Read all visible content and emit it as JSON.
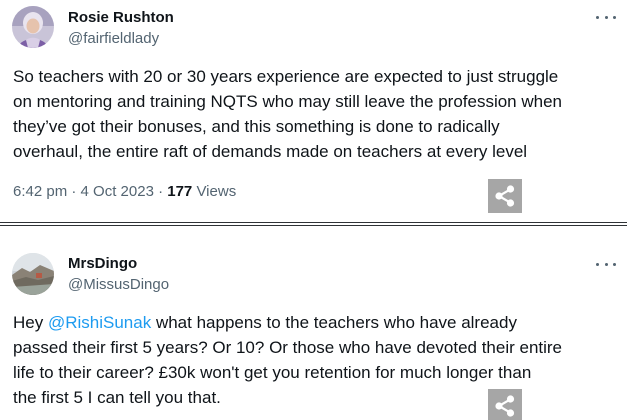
{
  "tweets": [
    {
      "author_name": "Rosie Rushton",
      "author_handle": "@fairfieldlady",
      "avatar_icon": "avatar-woman-photo",
      "body_lines": [
        "So teachers with 20 or 30 years experience are expected to just struggle",
        "on mentoring and training NQTS who may still leave the profession when",
        "they’ve got their bonuses, and this something is done to radically",
        "overhaul, the entire raft of demands made on teachers at every level"
      ],
      "timestamp": "6:42 pm · 4 Oct 2023 ·",
      "views_count": "177",
      "views_label": "Views",
      "more_icon": "more-horizontal-icon",
      "share_icon": "share-icon"
    },
    {
      "author_name": "MrsDingo",
      "author_handle": "@MissusDingo",
      "avatar_icon": "avatar-landscape-photo",
      "mention": "@RishiSunak",
      "body_line1_rest": " what happens to the teachers who have already",
      "body_line1_prefix": "Hey ",
      "body_lines": [
        "passed their first 5 years? Or 10? Or those who have devoted their entire",
        "life to their career? £30k won't get you retention for much longer than",
        "the first 5 I can tell you that."
      ],
      "more_icon": "more-horizontal-icon",
      "share_icon": "share-icon"
    }
  ],
  "colors": {
    "text": "#0f1419",
    "secondary": "#536471",
    "mention": "#1d9bf0",
    "share_button": "#a6a6a6",
    "divider": "#2f3336"
  }
}
